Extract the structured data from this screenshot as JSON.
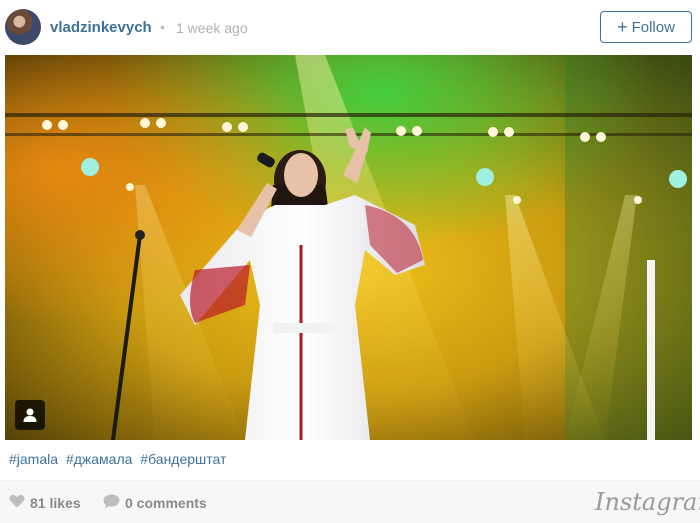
{
  "post": {
    "username": "vladzinkevych",
    "separator": "•",
    "time_ago": "1 week ago",
    "follow_label": "Follow"
  },
  "caption": {
    "hashtags": [
      "#jamala",
      "#джамала",
      "#бандерштат"
    ]
  },
  "stats": {
    "likes": "81 likes",
    "comments": "0 comments"
  },
  "brand": {
    "name": "Instagram"
  },
  "icons": {
    "follow": "plus-icon",
    "likes": "heart-icon",
    "comments": "comment-bubble-icon",
    "tag": "person-tag-icon"
  },
  "colors": {
    "link": "#3f729b",
    "muted": "#8a8a8a",
    "footer_bg": "#f7f7f7"
  }
}
